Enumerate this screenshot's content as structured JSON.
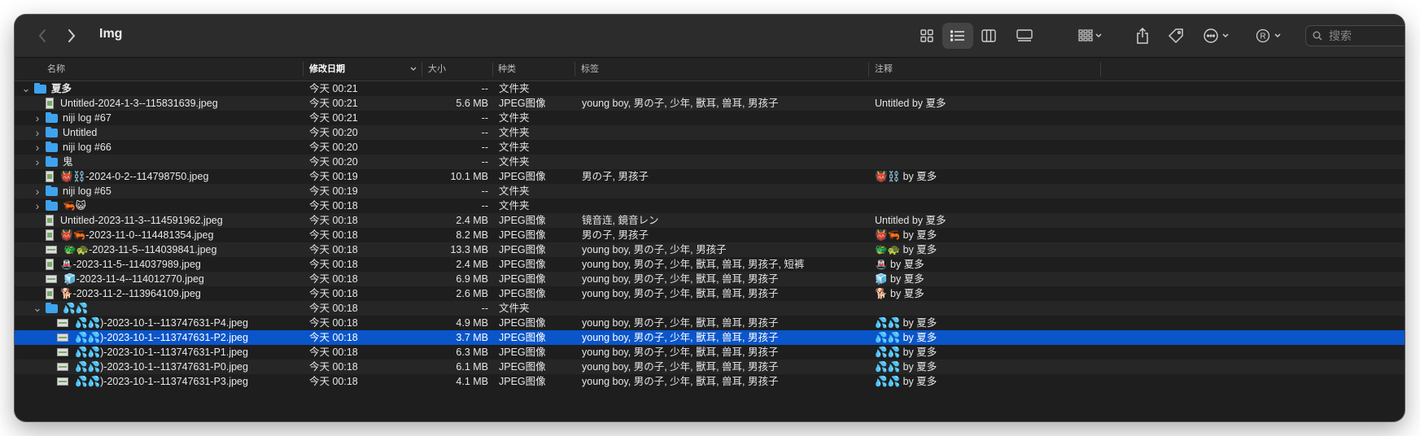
{
  "window": {
    "title": "Img"
  },
  "toolbar": {
    "back_icon": "chevron-left-icon",
    "forward_icon": "chevron-right-icon",
    "search_placeholder": "搜索"
  },
  "columns": {
    "name": "名称",
    "date": "修改日期",
    "size": "大小",
    "kind": "种类",
    "tags": "标签",
    "notes": "注释"
  },
  "rows": [
    {
      "indent": 0,
      "type": "folder",
      "disclosure": "open",
      "name": "夏多",
      "date": "今天 00:21",
      "size": "--",
      "kind": "文件夹",
      "tags": "",
      "notes": ""
    },
    {
      "indent": 1,
      "type": "file",
      "disclosure": "",
      "name": "Untitled-2024-1-3--115831639.jpeg",
      "date": "今天 00:21",
      "size": "5.6 MB",
      "kind": "JPEG图像",
      "tags": "young boy, 男の子, 少年, 獸耳, 兽耳, 男孩子",
      "notes": "Untitled by 夏多"
    },
    {
      "indent": 1,
      "type": "folder",
      "disclosure": "closed",
      "name": "niji log #67",
      "date": "今天 00:21",
      "size": "--",
      "kind": "文件夹",
      "tags": "",
      "notes": ""
    },
    {
      "indent": 1,
      "type": "folder",
      "disclosure": "closed",
      "name": "Untitled",
      "date": "今天 00:20",
      "size": "--",
      "kind": "文件夹",
      "tags": "",
      "notes": ""
    },
    {
      "indent": 1,
      "type": "folder",
      "disclosure": "closed",
      "name": "niji log #66",
      "date": "今天 00:20",
      "size": "--",
      "kind": "文件夹",
      "tags": "",
      "notes": ""
    },
    {
      "indent": 1,
      "type": "folder",
      "disclosure": "closed",
      "name": "鬼",
      "date": "今天 00:20",
      "size": "--",
      "kind": "文件夹",
      "tags": "",
      "notes": ""
    },
    {
      "indent": 1,
      "type": "file",
      "disclosure": "",
      "name": "👹⛓️-2024-0-2--114798750.jpeg",
      "date": "今天 00:19",
      "size": "10.1 MB",
      "kind": "JPEG图像",
      "tags": "男の子, 男孩子",
      "notes": "👹⛓️ by 夏多"
    },
    {
      "indent": 1,
      "type": "folder",
      "disclosure": "closed",
      "name": "niji log #65",
      "date": "今天 00:19",
      "size": "--",
      "kind": "文件夹",
      "tags": "",
      "notes": ""
    },
    {
      "indent": 1,
      "type": "folder",
      "disclosure": "closed",
      "name": "🦐😺",
      "date": "今天 00:18",
      "size": "--",
      "kind": "文件夹",
      "tags": "",
      "notes": ""
    },
    {
      "indent": 1,
      "type": "file",
      "disclosure": "",
      "name": "Untitled-2023-11-3--114591962.jpeg",
      "date": "今天 00:18",
      "size": "2.4 MB",
      "kind": "JPEG图像",
      "tags": "镜音连, 鏡音レン",
      "notes": "Untitled by 夏多"
    },
    {
      "indent": 1,
      "type": "file",
      "disclosure": "",
      "name": "👹🦐-2023-11-0--114481354.jpeg",
      "date": "今天 00:18",
      "size": "8.2 MB",
      "kind": "JPEG图像",
      "tags": "男の子, 男孩子",
      "notes": "👹🦐 by 夏多"
    },
    {
      "indent": 1,
      "type": "file",
      "disclosure": "",
      "land": true,
      "name": "🐲🐢-2023-11-5--114039841.jpeg",
      "date": "今天 00:18",
      "size": "13.3 MB",
      "kind": "JPEG图像",
      "tags": "young boy, 男の子, 少年, 男孩子",
      "notes": "🐲🐢 by 夏多"
    },
    {
      "indent": 1,
      "type": "file",
      "disclosure": "",
      "name": "🚇-2023-11-5--114037989.jpeg",
      "date": "今天 00:18",
      "size": "2.4 MB",
      "kind": "JPEG图像",
      "tags": "young boy, 男の子, 少年, 獸耳, 兽耳, 男孩子, 短裤",
      "notes": "🚇 by 夏多"
    },
    {
      "indent": 1,
      "type": "file",
      "disclosure": "",
      "land": true,
      "name": "🧊-2023-11-4--114012770.jpeg",
      "date": "今天 00:18",
      "size": "6.9 MB",
      "kind": "JPEG图像",
      "tags": "young boy, 男の子, 少年, 獸耳, 兽耳, 男孩子",
      "notes": "🧊 by 夏多"
    },
    {
      "indent": 1,
      "type": "file",
      "disclosure": "",
      "name": "🐕-2023-11-2--113964109.jpeg",
      "date": "今天 00:18",
      "size": "2.6 MB",
      "kind": "JPEG图像",
      "tags": "young boy, 男の子, 少年, 獸耳, 兽耳, 男孩子",
      "notes": "🐕 by 夏多"
    },
    {
      "indent": 1,
      "type": "folder",
      "disclosure": "open",
      "name": "💦💦",
      "date": "今天 00:18",
      "size": "--",
      "kind": "文件夹",
      "tags": "",
      "notes": ""
    },
    {
      "indent": 2,
      "type": "file",
      "disclosure": "",
      "land": true,
      "name": "💦💦)-2023-10-1--113747631-P4.jpeg",
      "date": "今天 00:18",
      "size": "4.9 MB",
      "kind": "JPEG图像",
      "tags": "young boy, 男の子, 少年, 獸耳, 兽耳, 男孩子",
      "notes": "💦💦 by 夏多"
    },
    {
      "indent": 2,
      "type": "file",
      "disclosure": "",
      "land": true,
      "selected": true,
      "name": "💦💦)-2023-10-1--113747631-P2.jpeg",
      "date": "今天 00:18",
      "size": "3.7 MB",
      "kind": "JPEG图像",
      "tags": "young boy, 男の子, 少年, 獸耳, 兽耳, 男孩子",
      "notes": "💦💦 by 夏多"
    },
    {
      "indent": 2,
      "type": "file",
      "disclosure": "",
      "land": true,
      "name": "💦💦)-2023-10-1--113747631-P1.jpeg",
      "date": "今天 00:18",
      "size": "6.3 MB",
      "kind": "JPEG图像",
      "tags": "young boy, 男の子, 少年, 獸耳, 兽耳, 男孩子",
      "notes": "💦💦 by 夏多"
    },
    {
      "indent": 2,
      "type": "file",
      "disclosure": "",
      "land": true,
      "name": "💦💦)-2023-10-1--113747631-P0.jpeg",
      "date": "今天 00:18",
      "size": "6.1 MB",
      "kind": "JPEG图像",
      "tags": "young boy, 男の子, 少年, 獸耳, 兽耳, 男孩子",
      "notes": "💦💦 by 夏多"
    },
    {
      "indent": 2,
      "type": "file",
      "disclosure": "",
      "land": true,
      "name": "💦💦)-2023-10-1--113747631-P3.jpeg",
      "date": "今天 00:18",
      "size": "4.1 MB",
      "kind": "JPEG图像",
      "tags": "young boy, 男の子, 少年, 獸耳, 兽耳, 男孩子",
      "notes": "💦💦 by 夏多"
    }
  ]
}
